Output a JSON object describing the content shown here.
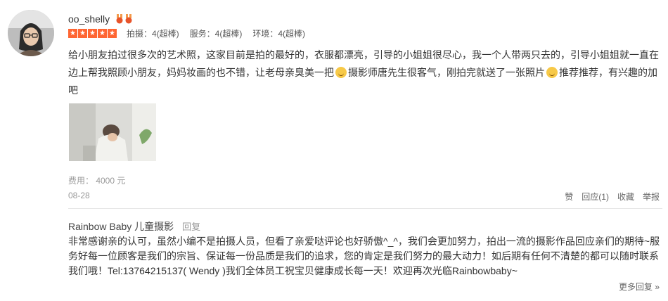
{
  "review": {
    "username": "oo_shelly",
    "ratings": [
      {
        "label": "拍摄：4(超棒)"
      },
      {
        "label": "服务：4(超棒)"
      },
      {
        "label": "环境：4(超棒)"
      }
    ],
    "text_part1": "给小朋友拍过很多次的艺术照，这家目前是拍的最好的，衣服都漂亮，引导的小姐姐很尽心，我一个人带两只去的，引导小姐姐就一直在边上帮我照顾小朋友，妈妈妆画的也不错，让老母亲臭美一把",
    "text_part2": "摄影师唐先生很客气，刚拍完就送了一张照片",
    "text_part3": "推荐推荐，有兴趣的加吧",
    "fee": "费用： 4000 元",
    "date": "08-28",
    "actions": {
      "like": "赞",
      "reply": "回应(1)",
      "favorite": "收藏",
      "report": "举报"
    }
  },
  "merchant_reply": {
    "name": "Rainbow Baby 儿童摄影",
    "reply_link": "回复",
    "text": "非常感谢亲的认可，虽然小编不是拍摄人员，但看了亲爱哒评论也好骄傲^_^，我们会更加努力，拍出一流的摄影作品回应亲们的期待~服务好每一位顾客是我们的宗旨、保证每一份品质是我们的追求，您的肯定是我们努力的最大动力！如后期有任何不清楚的都可以随时联系我们哦！Tel:13764215137( Wendy )我们全体员工祝宝贝健康成长每一天！欢迎再次光临Rainbowbaby~",
    "more": "更多回复 »"
  },
  "colors": {
    "star": "#ff6633",
    "medal": "#e8542a",
    "divider": "#e6e6e6"
  },
  "icons": {
    "stars": 5,
    "medals": 2,
    "emoji": "smiley-emoji"
  }
}
